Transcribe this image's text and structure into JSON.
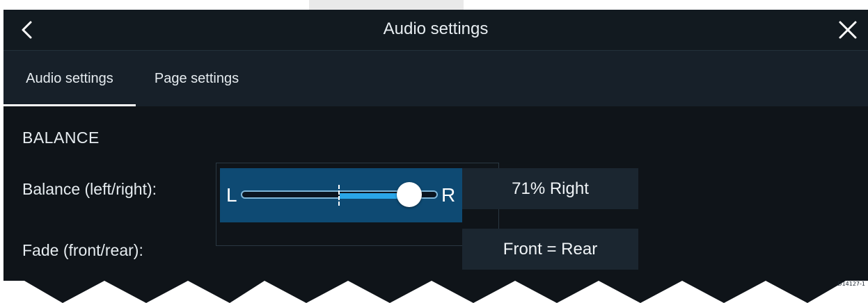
{
  "document": {
    "partial_text": "                         ",
    "reference_code": "D14127-1"
  },
  "header": {
    "title": "Audio settings",
    "back_icon": "chevron-left-icon",
    "close_icon": "close-icon"
  },
  "tabs": [
    {
      "label": "Audio settings",
      "selected": true
    },
    {
      "label": "Page settings",
      "selected": false
    }
  ],
  "section": {
    "title": "BALANCE"
  },
  "balance": {
    "label": "Balance (left/right):",
    "left_label": "L",
    "right_label": "R",
    "value_text": "71% Right",
    "position_fraction": 0.855
  },
  "fade": {
    "label": "Fade (front/rear):",
    "value_text": "Front = Rear"
  },
  "colors": {
    "accent": "#2aa6e8",
    "panel": "#0e4a73",
    "background": "#0f1419"
  }
}
